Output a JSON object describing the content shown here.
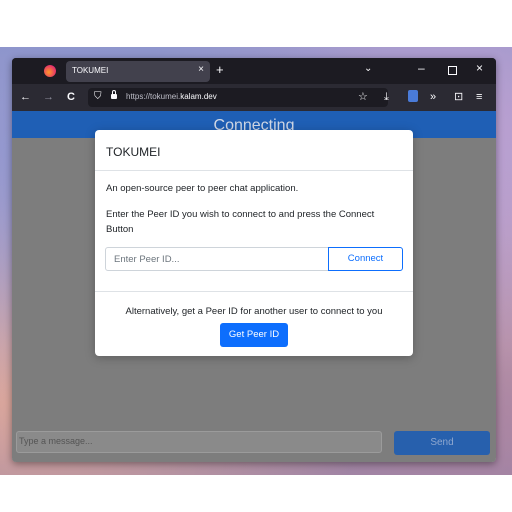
{
  "browser": {
    "tab_title": "TOKUMEI",
    "tab_close": "×",
    "new_tab": "+",
    "tab_list": "⌄",
    "window_minimize": "–",
    "window_close": "×",
    "url_prefix": "https://tokumei.",
    "url_domain": "kalam.dev",
    "nav_back": "←",
    "nav_forward": "→",
    "nav_reload": "C",
    "toolbar_icons": [
      "star-icon",
      "download-icon",
      "extension-icon",
      "overflow-icon",
      "puzzle-icon",
      "menu-icon"
    ],
    "toolbar_glyphs": {
      "star": "☆",
      "download": "⤓",
      "overflow": "»",
      "puzzle": "⊡",
      "menu": "≡",
      "shield": "⛉"
    }
  },
  "page": {
    "header_title": "Connecting",
    "message_placeholder": "Type a message...",
    "send_label": "Send"
  },
  "modal": {
    "title": "TOKUMEI",
    "intro": "An open-source peer to peer chat application.",
    "instruction": "Enter the Peer ID you wish to connect to and press the Connect Button",
    "peer_input_placeholder": "Enter Peer ID...",
    "connect_label": "Connect",
    "alternative_text": "Alternatively, get a Peer ID for another user to connect to you",
    "get_peer_id_label": "Get Peer ID"
  },
  "colors": {
    "primary": "#0d6efd",
    "header_blue": "#1f5fb5",
    "browser_chrome": "#2b2a33"
  }
}
